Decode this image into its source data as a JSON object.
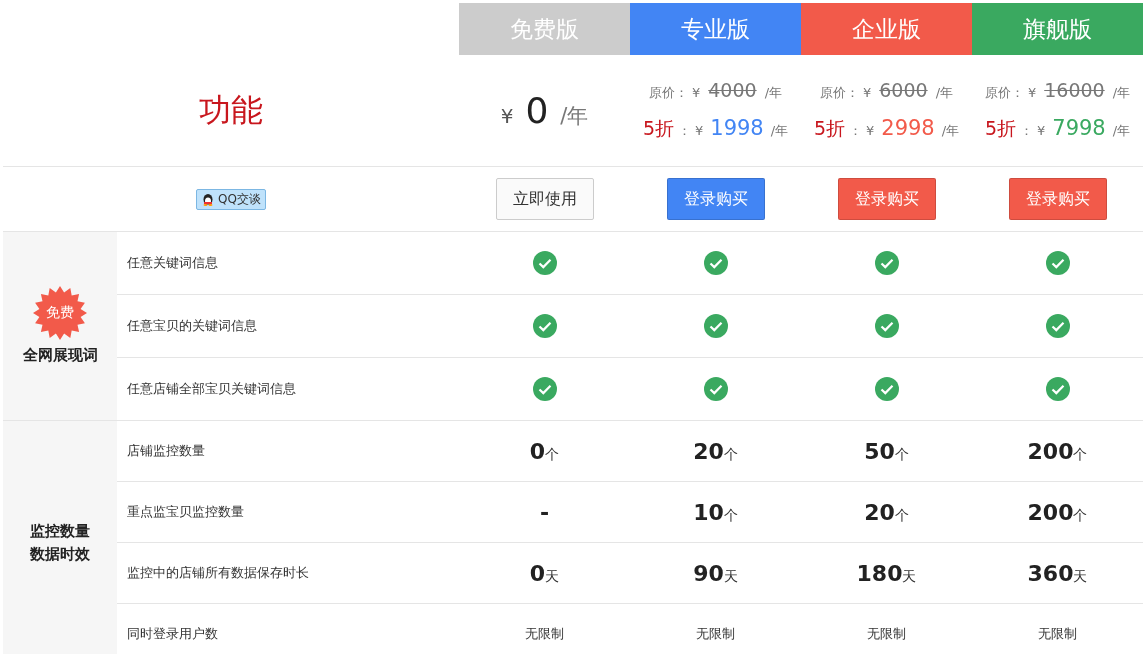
{
  "feature_heading": "功能",
  "qq_button": {
    "label": "QQ交谈"
  },
  "plans": [
    {
      "name": "免费版",
      "color": "#cccccc",
      "price": {
        "kind": "free",
        "currency": "¥",
        "amount": "0",
        "unit": "/年"
      },
      "button": {
        "label": "立即使用",
        "kind": "outline"
      }
    },
    {
      "name": "专业版",
      "color": "#4285f4",
      "price": {
        "kind": "discount",
        "original_label": "原价：",
        "currency": "¥",
        "original": "4000",
        "unit": "/年",
        "discount": "5折",
        "separator": "：",
        "sale_currency": "¥",
        "sale": "1998",
        "sale_unit": "/年"
      },
      "button": {
        "label": "登录购买",
        "kind": "solid",
        "color": "#4285f4"
      }
    },
    {
      "name": "企业版",
      "color": "#f25a4a",
      "price": {
        "kind": "discount",
        "original_label": "原价：",
        "currency": "¥",
        "original": "6000",
        "unit": "/年",
        "discount": "5折",
        "separator": "：",
        "sale_currency": "¥",
        "sale": "2998",
        "sale_unit": "/年"
      },
      "button": {
        "label": "登录购买",
        "kind": "solid",
        "color": "#f25a4a"
      }
    },
    {
      "name": "旗舰版",
      "color": "#3aa960",
      "price": {
        "kind": "discount",
        "original_label": "原价：",
        "currency": "¥",
        "original": "16000",
        "unit": "/年",
        "discount": "5折",
        "separator": "：",
        "sale_currency": "¥",
        "sale": "7998",
        "sale_unit": "/年"
      },
      "button": {
        "label": "登录购买",
        "kind": "solid",
        "color": "#f25a4a"
      }
    }
  ],
  "groups": [
    {
      "title_lines": [
        "全网展现词"
      ],
      "badge": "免费",
      "rows": [
        {
          "label": "任意关键词信息",
          "cells": [
            {
              "kind": "check"
            },
            {
              "kind": "check"
            },
            {
              "kind": "check"
            },
            {
              "kind": "check"
            }
          ]
        },
        {
          "label": "任意宝贝的关键词信息",
          "cells": [
            {
              "kind": "check"
            },
            {
              "kind": "check"
            },
            {
              "kind": "check"
            },
            {
              "kind": "check"
            }
          ]
        },
        {
          "label": "任意店铺全部宝贝关键词信息",
          "cells": [
            {
              "kind": "check"
            },
            {
              "kind": "check"
            },
            {
              "kind": "check"
            },
            {
              "kind": "check"
            }
          ]
        }
      ]
    },
    {
      "title_lines": [
        "监控数量",
        "数据时效"
      ],
      "rows": [
        {
          "label": "店铺监控数量",
          "cells": [
            {
              "kind": "value",
              "value": "0",
              "unit": "个"
            },
            {
              "kind": "value",
              "value": "20",
              "unit": "个"
            },
            {
              "kind": "value",
              "value": "50",
              "unit": "个"
            },
            {
              "kind": "value",
              "value": "200",
              "unit": "个"
            }
          ]
        },
        {
          "label": "重点监宝贝监控数量",
          "cells": [
            {
              "kind": "value",
              "value": "-"
            },
            {
              "kind": "value",
              "value": "10",
              "unit": "个"
            },
            {
              "kind": "value",
              "value": "20",
              "unit": "个"
            },
            {
              "kind": "value",
              "value": "200",
              "unit": "个"
            }
          ]
        },
        {
          "label": "监控中的店铺所有数据保存时长",
          "cells": [
            {
              "kind": "value",
              "value": "0",
              "unit": "天"
            },
            {
              "kind": "value",
              "value": "90",
              "unit": "天"
            },
            {
              "kind": "value",
              "value": "180",
              "unit": "天"
            },
            {
              "kind": "value",
              "value": "360",
              "unit": "天"
            }
          ]
        },
        {
          "label": "同时登录用户数",
          "cells": [
            {
              "kind": "text",
              "text": "无限制"
            },
            {
              "kind": "text",
              "text": "无限制"
            },
            {
              "kind": "text",
              "text": "无限制"
            },
            {
              "kind": "text",
              "text": "无限制"
            }
          ]
        }
      ]
    }
  ]
}
